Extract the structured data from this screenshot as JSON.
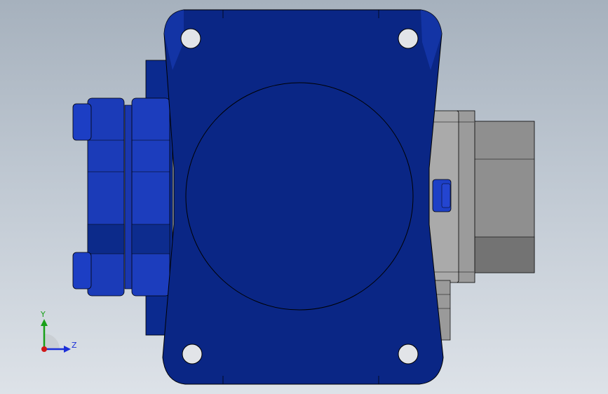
{
  "triad": {
    "y_label": "Y",
    "z_label": "Z",
    "colors": {
      "y": "#19a019",
      "z": "#1b2fd8",
      "x": "#d01818"
    }
  },
  "model": {
    "colors": {
      "housing": "#0a2685",
      "housing_light": "#1c3fc0",
      "housing_dark": "#07185a",
      "motor": "#9a9a9a",
      "motor_dark": "#6e6e6e",
      "motor_light": "#b8b8b8",
      "edge": "#000000"
    }
  }
}
